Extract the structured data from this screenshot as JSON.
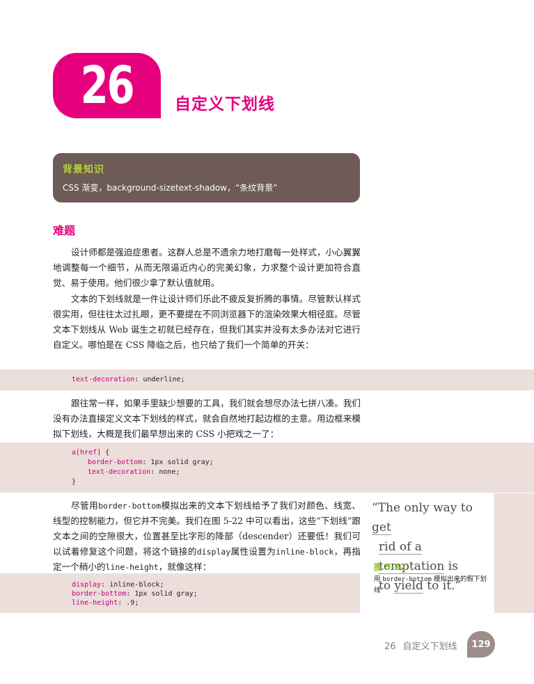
{
  "chapter": {
    "number": "26",
    "title": "自定义下划线"
  },
  "background": {
    "title": "背景知识",
    "text": "CSS 渐变，background-sizetext-shadow，“条纹背景”"
  },
  "section_title": "难题",
  "paragraphs": {
    "p1": "设计师都是强迫症患者。这群人总是不遗余力地打磨每一处样式，小心翼翼地调整每一个细节，从而无限逼近内心的完美幻象，力求整个设计更加符合直觉、易于使用。他们很少拿了默认值就用。",
    "p2": "文本的下划线就是一件让设计师们乐此不疲反复折腾的事情。尽管默认样式很实用，但往往太过扎眼，更不要提在不同浏览器下的渲染效果大相径庭。尽管文本下划线从 Web 诞生之初就已经存在，但我们其实并没有太多办法对它进行自定义。哪怕是在 CSS 降临之后，也只给了我们一个简单的开关：",
    "p3": "跟往常一样，如果手里缺少想要的工具，我们就会想尽办法七拼八凑。我们没有办法直接定义文本下划线的样式，就会自然地打起边框的主意。用边框来模拟下划线，大概是我们最早想出来的 CSS 小把戏之一了：",
    "p4_a": "尽管用",
    "p4_code1": "border-bottom",
    "p4_b": "模拟出来的文本下划线给予了我们对颜色、线宽、线型的控制能力，但它并不完美。我们在图 5-22 中可以看出，这些“下划线”跟文本之间的空隙很大，位置甚至比字形的降部（descender）还要低！我们可以试着修复这个问题，将这个链接的",
    "p4_code2": "display",
    "p4_c": "属性设置为",
    "p4_code3": "inline-block",
    "p4_d": "，再指定一个稍小的",
    "p4_code4": "line-height",
    "p4_e": "，就像这样："
  },
  "code1": {
    "prop": "text-decoration",
    "value": ": underline;"
  },
  "code2": {
    "selector": "a[href]",
    "open": " {",
    "l1_prop": "border-bottom",
    "l1_val": ": 1px solid gray;",
    "l2_prop": "text-decoration",
    "l2_val": ": none;",
    "close": "}"
  },
  "code3": {
    "l1_prop": "display",
    "l1_val": ": inline-block;",
    "l2_prop": "border-bottom",
    "l2_val": ": 1px solid gray;",
    "l3_prop": "line-height",
    "l3_val": ": .9;"
  },
  "figure": {
    "quote_l1a": "“The only way to ",
    "quote_l1b": "get",
    "quote_l2a": "rid of a temptation",
    "quote_l2b": " is",
    "quote_l3a": "to ",
    "quote_l3b": "yield",
    "quote_l3c": " to it.”",
    "label": "图 5-22",
    "caption_a": "用 ",
    "caption_code": "border-bottom",
    "caption_b": " 模拟出来的假下划线"
  },
  "footer": {
    "chapter_num": "26",
    "chapter_title": "自定义下划线",
    "page": "129"
  },
  "colors": {
    "accent": "#e6007e",
    "green": "#8cbf26",
    "box": "#6e5a57",
    "code_bg": "#ecdedb"
  }
}
